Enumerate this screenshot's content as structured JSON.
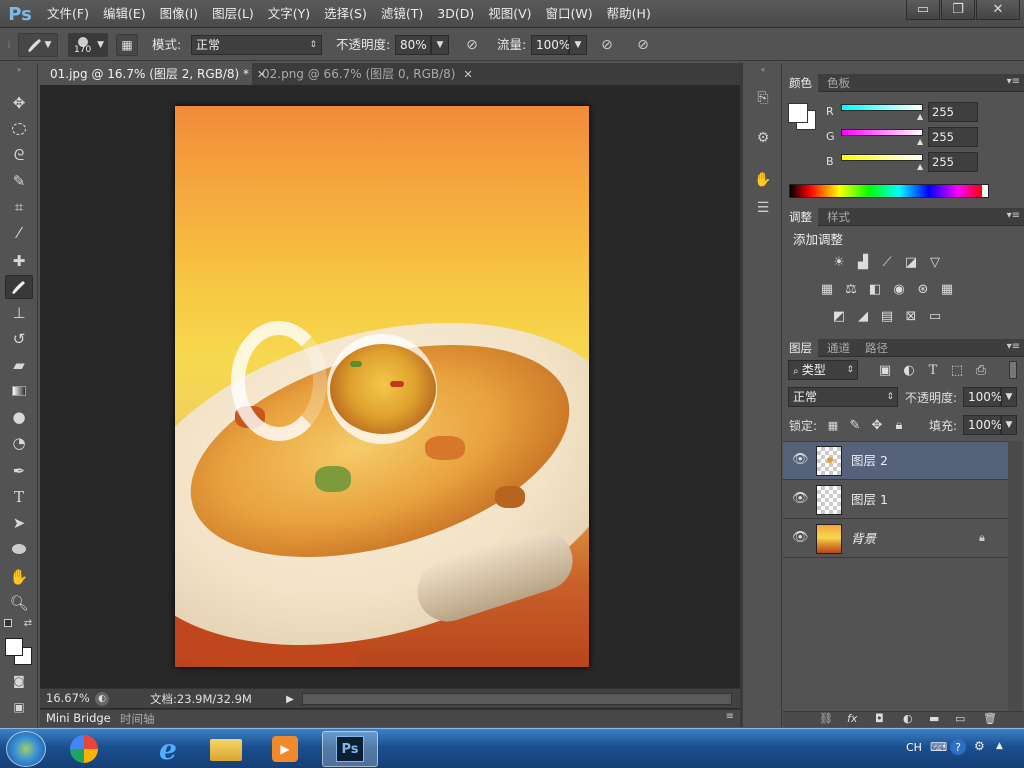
{
  "app": {
    "logo": "Ps"
  },
  "menu": [
    "文件(F)",
    "编辑(E)",
    "图像(I)",
    "图层(L)",
    "文字(Y)",
    "选择(S)",
    "滤镜(T)",
    "3D(D)",
    "视图(V)",
    "窗口(W)",
    "帮助(H)"
  ],
  "window_controls": {
    "minimize": "▭",
    "restore": "❐",
    "close": "✕"
  },
  "options": {
    "brush_size": "170",
    "mode_label": "模式:",
    "mode_value": "正常",
    "opacity_label": "不透明度:",
    "opacity_value": "80%",
    "flow_label": "流量:",
    "flow_value": "100%"
  },
  "tools": [
    "move-tool-icon",
    "marquee-tool-icon",
    "lasso-tool-icon",
    "quick-select-tool-icon",
    "crop-tool-icon",
    "eyedropper-tool-icon",
    "healing-tool-icon",
    "brush-tool-icon",
    "stamp-tool-icon",
    "history-brush-tool-icon",
    "eraser-tool-icon",
    "gradient-tool-icon",
    "blur-tool-icon",
    "dodge-tool-icon",
    "pen-tool-icon",
    "type-tool-icon",
    "path-select-tool-icon",
    "ellipse-tool-icon",
    "hand-tool-icon",
    "zoom-tool-icon"
  ],
  "tabs": [
    {
      "label": "01.jpg @ 16.7% (图层 2, RGB/8) *",
      "close": "✕"
    },
    {
      "label": "02.png @ 66.7% (图层 0, RGB/8)",
      "close": "✕"
    }
  ],
  "status": {
    "zoom": "16.67%",
    "doc": "文档:23.9M/32.9M"
  },
  "bridge": {
    "tab1": "Mini Bridge",
    "tab2": "时间轴"
  },
  "color_panel": {
    "tab_active": "颜色",
    "tab_inactive": "色板",
    "channels": [
      {
        "label": "R",
        "value": "255",
        "color": "#00ffff"
      },
      {
        "label": "G",
        "value": "255",
        "color": "#ff00ff"
      },
      {
        "label": "B",
        "value": "255",
        "color": "#ffff00"
      }
    ]
  },
  "adjust_panel": {
    "tab_active": "调整",
    "tab_inactive": "样式",
    "heading": "添加调整"
  },
  "layers_panel": {
    "tabs": [
      "图层",
      "通道",
      "路径"
    ],
    "filter_label": "类型",
    "blend": "正常",
    "opacity_label": "不透明度:",
    "opacity_value": "100%",
    "lock_label": "锁定:",
    "fill_label": "填充:",
    "fill_value": "100%",
    "layers": [
      {
        "name": "图层 2",
        "selected": true
      },
      {
        "name": "图层 1",
        "selected": false
      },
      {
        "name": "背景",
        "selected": false,
        "locked": true
      }
    ]
  },
  "taskbar": {
    "lang": "CH"
  },
  "colors": {
    "accent_selected": "#55627a",
    "ps_blue": "#7fb9e6"
  }
}
